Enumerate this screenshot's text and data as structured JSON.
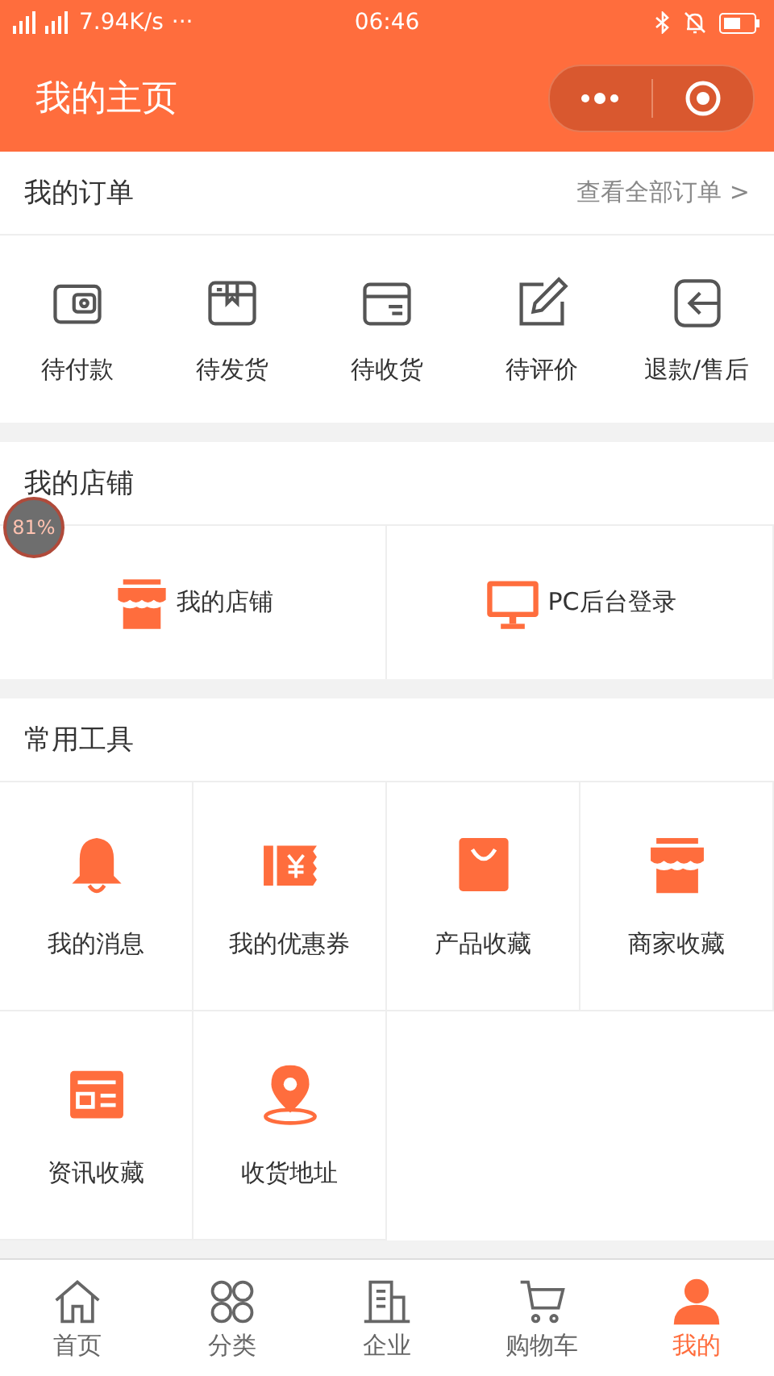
{
  "status_bar": {
    "speed": "7.94K/s",
    "more": "···",
    "time": "06:46"
  },
  "nav": {
    "title": "我的主页"
  },
  "orders": {
    "title": "我的订单",
    "link": "查看全部订单 >",
    "items": [
      {
        "kind": "wallet",
        "label": "待付款"
      },
      {
        "kind": "package",
        "label": "待发货"
      },
      {
        "kind": "box",
        "label": "待收货"
      },
      {
        "kind": "edit",
        "label": "待评价"
      },
      {
        "kind": "return",
        "label": "退款/售后"
      }
    ]
  },
  "shop": {
    "title": "我的店铺",
    "badge": "81%",
    "items": [
      {
        "kind": "store",
        "label": "我的店铺"
      },
      {
        "kind": "monitor",
        "label": "PC后台登录"
      }
    ]
  },
  "tools": {
    "title": "常用工具",
    "items": [
      {
        "kind": "bell",
        "label": "我的消息"
      },
      {
        "kind": "coupon",
        "label": "我的优惠券"
      },
      {
        "kind": "bag",
        "label": "产品收藏"
      },
      {
        "kind": "store",
        "label": "商家收藏"
      },
      {
        "kind": "news",
        "label": "资讯收藏"
      },
      {
        "kind": "pin",
        "label": "收货地址"
      }
    ]
  },
  "tab_bar": [
    {
      "kind": "home",
      "label": "首页",
      "selected": false
    },
    {
      "kind": "grid",
      "label": "分类",
      "selected": false
    },
    {
      "kind": "building",
      "label": "企业",
      "selected": false
    },
    {
      "kind": "cart",
      "label": "购物车",
      "selected": false
    },
    {
      "kind": "person",
      "label": "我的",
      "selected": true
    }
  ]
}
